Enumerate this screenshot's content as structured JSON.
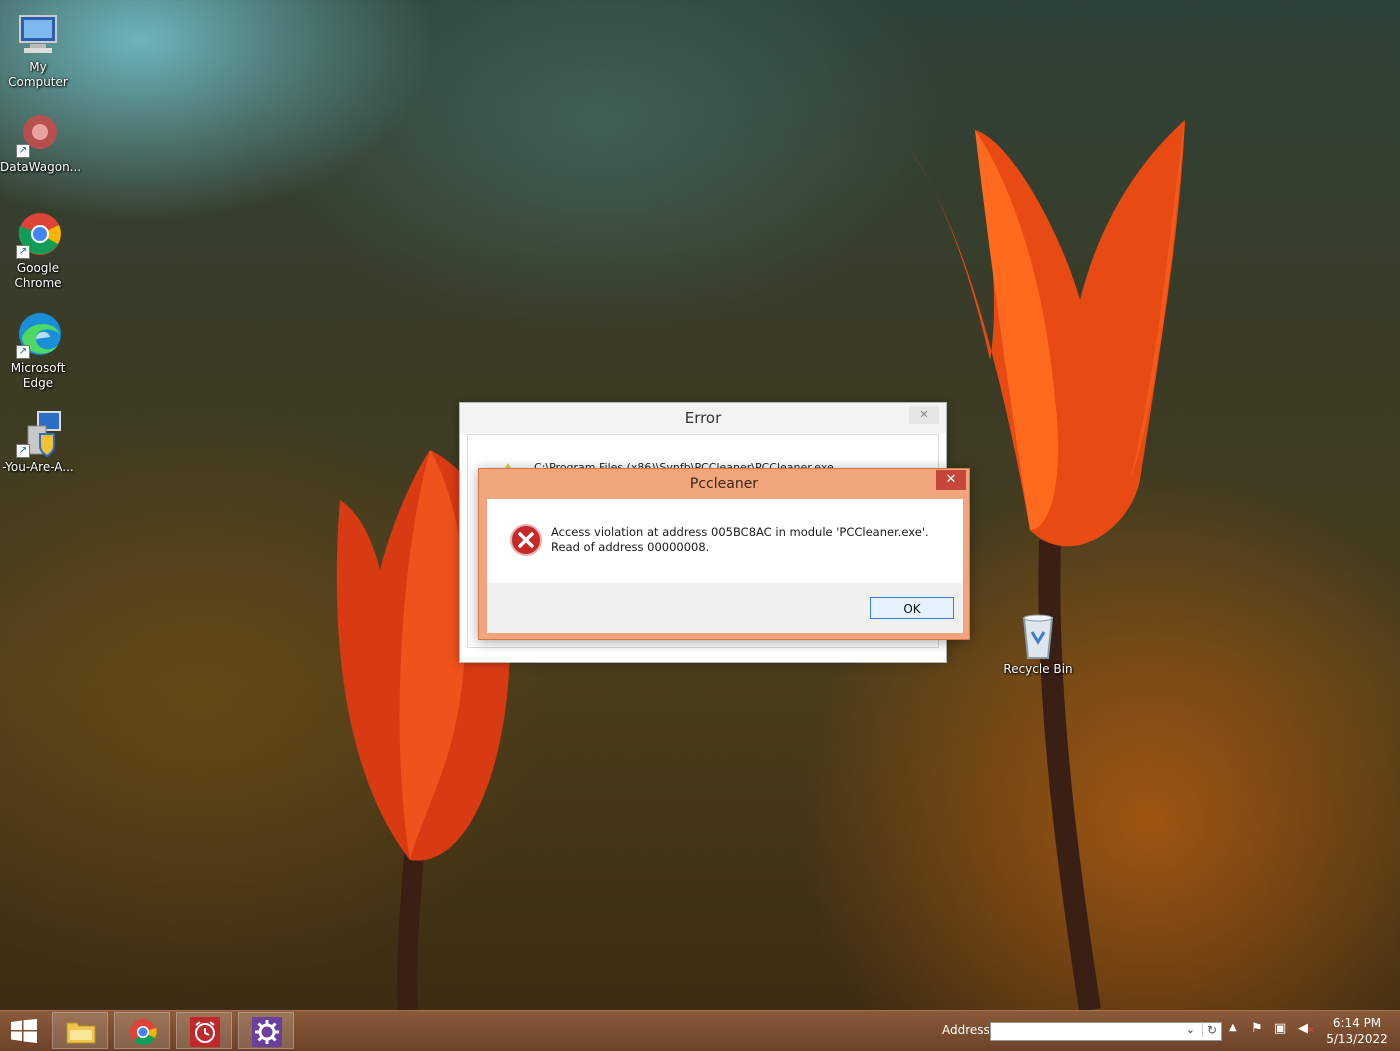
{
  "desktop_icons": [
    {
      "label": "My Computer",
      "icon": "computer-icon"
    },
    {
      "label": "DataWagon...",
      "icon": "datawagon-icon"
    },
    {
      "label": "Google Chrome",
      "icon": "chrome-icon"
    },
    {
      "label": "Microsoft Edge",
      "icon": "edge-icon"
    },
    {
      "label": "-You-Are-A...",
      "icon": "installer-icon"
    },
    {
      "label": "Recycle Bin",
      "icon": "recycle-bin-icon"
    }
  ],
  "error_dialog": {
    "title": "Error",
    "close_glyph": "✕",
    "path_text": "C:\\Program Files (x86)\\Synfb\\PCCleaner\\PCCleaner.exe"
  },
  "pccleaner_dialog": {
    "title": "Pccleaner",
    "close_glyph": "✕",
    "message": "Access violation at address 005BC8AC in module 'PCCleaner.exe'. Read of address 00000008.",
    "ok_label": "OK",
    "icon": "error-icon"
  },
  "taskbar": {
    "start_icon": "windows-start-icon",
    "pinned": [
      "file-explorer-icon",
      "chrome-icon",
      "alarm-clock-icon",
      "settings-icon"
    ],
    "address_label": "Address",
    "address_value": "",
    "time": "6:14 PM",
    "date": "5/13/2022"
  },
  "colors": {
    "dialog_accent": "#f0a57c",
    "close_red": "#c7453a",
    "taskbar": "#7a4e31"
  }
}
